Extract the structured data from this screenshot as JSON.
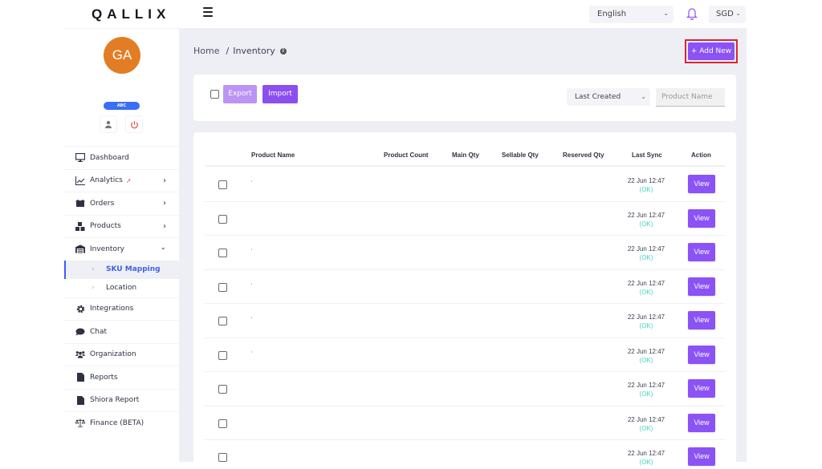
{
  "header": {
    "logo": "QALLIX",
    "language": "English",
    "currency": "SGD"
  },
  "user": {
    "initials": "GA",
    "badge": "ABC"
  },
  "sidebar": {
    "items": [
      {
        "label": "Dashboard",
        "icon": "monitor-icon",
        "expandable": false
      },
      {
        "label": "Analytics",
        "icon": "chart-line-icon",
        "expandable": true,
        "tag_icon": "rocket-icon"
      },
      {
        "label": "Orders",
        "icon": "box-open-icon",
        "expandable": true
      },
      {
        "label": "Products",
        "icon": "boxes-icon",
        "expandable": true
      },
      {
        "label": "Inventory",
        "icon": "warehouse-icon",
        "expandable": true,
        "expanded": true
      },
      {
        "label": "Integrations",
        "icon": "gear-icon",
        "expandable": false
      },
      {
        "label": "Chat",
        "icon": "chat-icon",
        "expandable": false
      },
      {
        "label": "Organization",
        "icon": "users-icon",
        "expandable": false
      },
      {
        "label": "Reports",
        "icon": "file-icon",
        "expandable": false
      },
      {
        "label": "Shiora Report",
        "icon": "file-icon",
        "expandable": false
      },
      {
        "label": "Finance (BETA)",
        "icon": "scale-icon",
        "expandable": false
      }
    ],
    "inventory_sub": [
      {
        "label": "SKU Mapping",
        "active": true
      },
      {
        "label": "Location",
        "active": false
      }
    ]
  },
  "breadcrumb": {
    "home": "Home",
    "separator": "/",
    "current": "Inventory",
    "info": "i"
  },
  "toolbar": {
    "add_new": "+ Add New",
    "export": "Export",
    "import": "Import",
    "sort_selected": "Last Created",
    "search_placeholder": "Product Name"
  },
  "table": {
    "columns": [
      "Product Name",
      "Product Count",
      "Main Qty",
      "Sellable Qty",
      "Reserved Qty",
      "Last Sync",
      "Action"
    ],
    "rows": [
      {
        "product_name": "",
        "last_sync": "22 Jun 12:47",
        "status": "(OK)",
        "action": "View"
      },
      {
        "product_name": "",
        "last_sync": "22 Jun 12:47",
        "status": "(OK)",
        "action": "View"
      },
      {
        "product_name": "",
        "last_sync": "22 Jun 12:47",
        "status": "(OK)",
        "action": "View"
      },
      {
        "product_name": "",
        "last_sync": "22 Jun 12:47",
        "status": "(OK)",
        "action": "View"
      },
      {
        "product_name": "",
        "last_sync": "22 Jun 12:47",
        "status": "(OK)",
        "action": "View"
      },
      {
        "product_name": "",
        "last_sync": "22 Jun 12:47",
        "status": "(OK)",
        "action": "View"
      },
      {
        "product_name": "",
        "last_sync": "22 Jun 12:47",
        "status": "(OK)",
        "action": "View"
      },
      {
        "product_name": "",
        "last_sync": "22 Jun 12:47",
        "status": "(OK)",
        "action": "View"
      },
      {
        "product_name": "",
        "last_sync": "22 Jun 12:47",
        "status": "(OK)",
        "action": "View"
      }
    ]
  },
  "colors": {
    "accent": "#8b52f5",
    "avatar": "#e27d25",
    "badge": "#3b6ef5",
    "ok_status": "#45d4c4",
    "highlight_border": "#e0232f",
    "active_nav": "#3d63e6"
  }
}
